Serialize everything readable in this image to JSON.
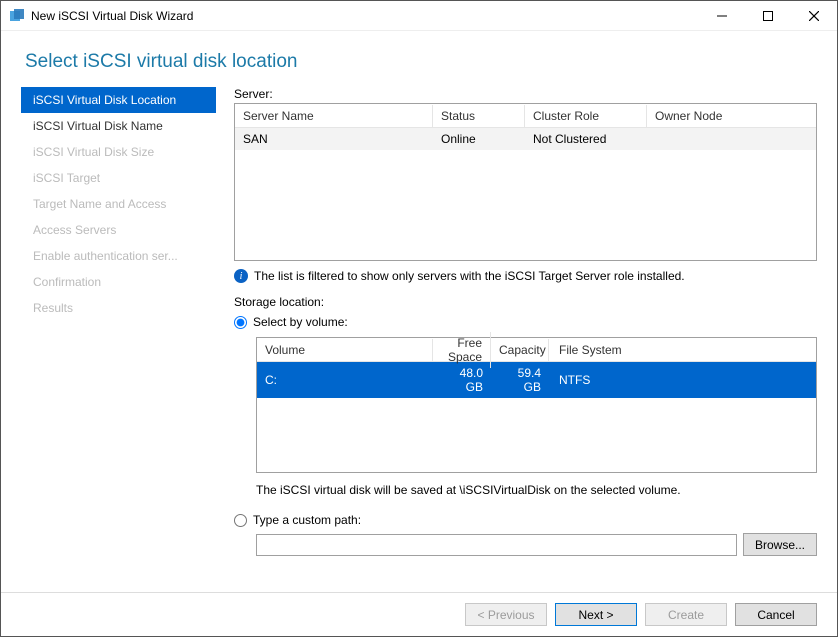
{
  "window": {
    "title": "New iSCSI Virtual Disk Wizard"
  },
  "heading": "Select iSCSI virtual disk location",
  "steps": [
    {
      "label": "iSCSI Virtual Disk Location",
      "state": "active"
    },
    {
      "label": "iSCSI Virtual Disk Name",
      "state": "enabled"
    },
    {
      "label": "iSCSI Virtual Disk Size",
      "state": "disabled"
    },
    {
      "label": "iSCSI Target",
      "state": "disabled"
    },
    {
      "label": "Target Name and Access",
      "state": "disabled"
    },
    {
      "label": "Access Servers",
      "state": "disabled"
    },
    {
      "label": "Enable authentication ser...",
      "state": "disabled"
    },
    {
      "label": "Confirmation",
      "state": "disabled"
    },
    {
      "label": "Results",
      "state": "disabled"
    }
  ],
  "server_section": {
    "label": "Server:",
    "columns": {
      "c1": "Server Name",
      "c2": "Status",
      "c3": "Cluster Role",
      "c4": "Owner Node"
    },
    "row": {
      "name": "SAN",
      "status": "Online",
      "cluster": "Not Clustered",
      "owner": ""
    },
    "info": "The list is filtered to show only servers with the iSCSI Target Server role installed."
  },
  "storage_section": {
    "label": "Storage location:",
    "radio_volume": "Select by volume:",
    "radio_custom": "Type a custom path:",
    "columns": {
      "c1": "Volume",
      "c2": "Free Space",
      "c3": "Capacity",
      "c4": "File System"
    },
    "row": {
      "volume": "C:",
      "free": "48.0 GB",
      "capacity": "59.4 GB",
      "fs": "NTFS"
    },
    "hint": "The iSCSI virtual disk will be saved at \\iSCSIVirtualDisk on the selected volume.",
    "browse": "Browse...",
    "custom_path": ""
  },
  "footer": {
    "prev": "< Previous",
    "next": "Next >",
    "create": "Create",
    "cancel": "Cancel"
  }
}
